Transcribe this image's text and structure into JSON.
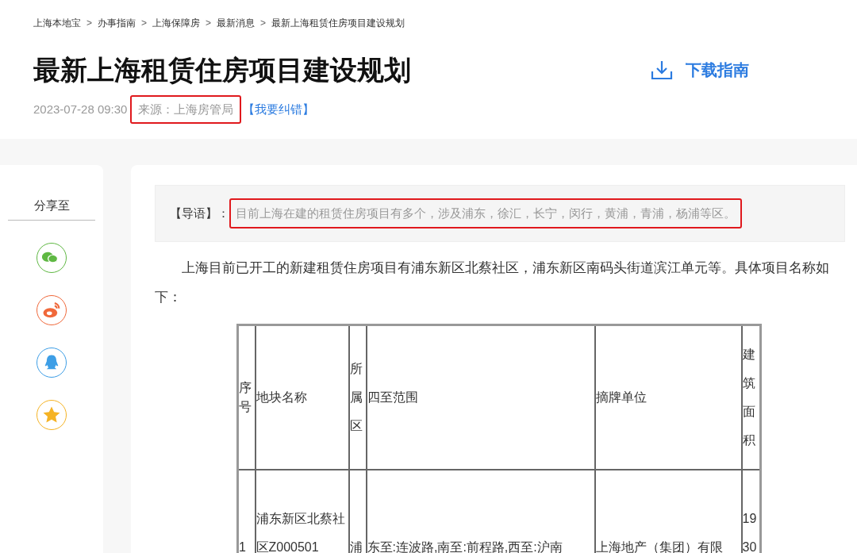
{
  "breadcrumb": [
    {
      "label": "上海本地宝"
    },
    {
      "separator": ">",
      "label": "办事指南"
    },
    {
      "separator": ">",
      "label": "上海保障房"
    },
    {
      "separator": ">",
      "label": "最新消息"
    },
    {
      "separator": ">",
      "label": "最新上海租赁住房项目建设规划"
    }
  ],
  "title": "最新上海租赁住房项目建设规划",
  "download": {
    "label": "下载指南"
  },
  "meta": {
    "date": "2023-07-28 09:30",
    "source": "来源：上海房管局",
    "source_highlighted": true,
    "report_link": "【我要纠错】"
  },
  "share": {
    "label": "分享至",
    "items": [
      {
        "kind": "wechat",
        "color": "#5fb843"
      },
      {
        "kind": "weibo",
        "color": "#f0683a"
      },
      {
        "kind": "qq",
        "color": "#3d9ee6"
      },
      {
        "kind": "qzone",
        "color": "#f5b324"
      }
    ]
  },
  "intro": {
    "label": "【导语】：",
    "text": "目前上海在建的租赁住房项目有多个，涉及浦东，徐汇，长宁，闵行，黄浦，青浦，杨浦等区。",
    "highlighted": true
  },
  "paragraph": "上海目前已开工的新建租赁住房项目有浦东新区北蔡社区，浦东新区南码头街道滨江单元等。具体项目名称如下：",
  "table": {
    "columns": [
      "序号",
      "地块名称",
      "所属区",
      "四至范围",
      "摘牌单位",
      "建筑面积"
    ],
    "rows": [
      [
        "1",
        "浦东新区北蔡社区Z000501",
        "浦",
        "东至:连波路,南至:前程路,西至:沪南",
        "上海地产（集团）有限",
        "1930"
      ]
    ]
  }
}
